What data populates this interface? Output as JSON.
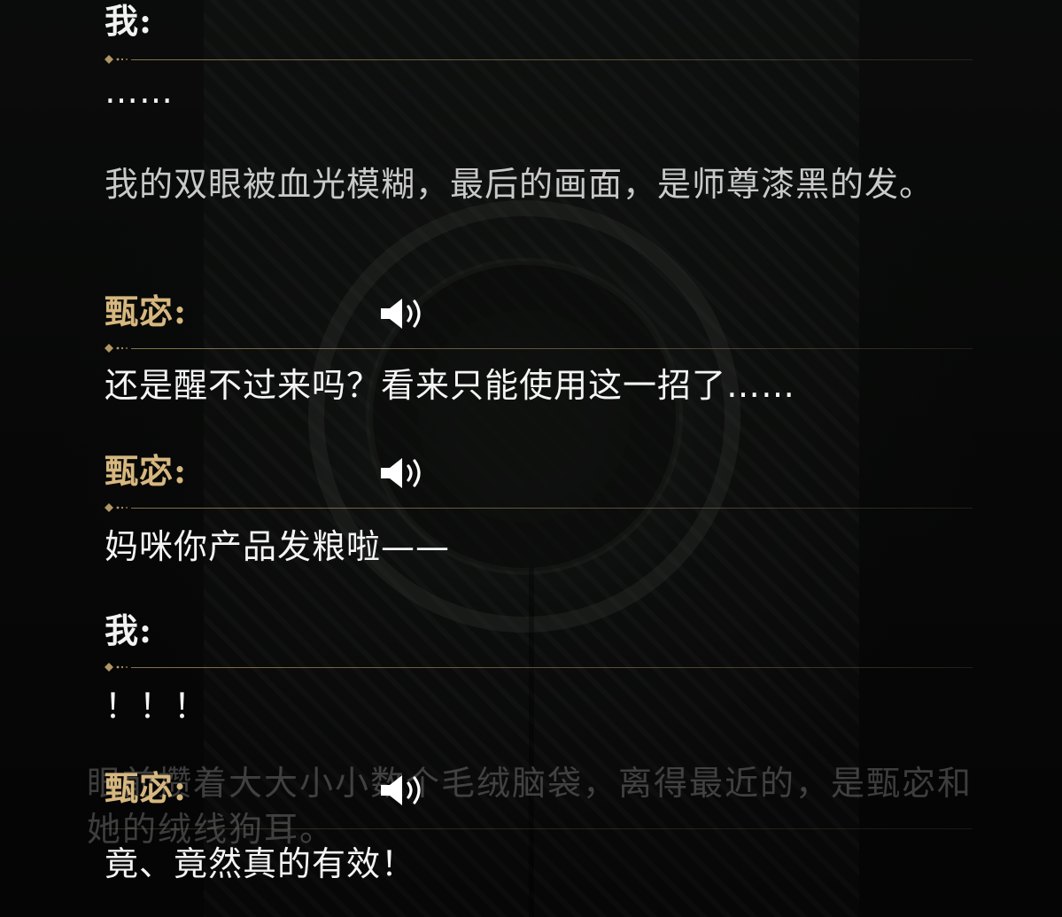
{
  "dialogue_log": [
    {
      "type": "dialogue",
      "speaker": "我:",
      "speaker_role": "player",
      "voice": false,
      "text": "……"
    },
    {
      "type": "narration",
      "text": "我的双眼被血光模糊，最后的画面，是师尊漆黑的发。"
    },
    {
      "type": "dialogue",
      "speaker": "甄宓:",
      "speaker_role": "npc",
      "voice": true,
      "text": "还是醒不过来吗？看来只能使用这一招了……"
    },
    {
      "type": "dialogue",
      "speaker": "甄宓:",
      "speaker_role": "npc",
      "voice": true,
      "text": "妈咪你产品发粮啦——"
    },
    {
      "type": "dialogue",
      "speaker": "我:",
      "speaker_role": "player",
      "voice": false,
      "text": "！！！"
    },
    {
      "type": "dialogue",
      "speaker": "甄宓:",
      "speaker_role": "npc",
      "voice": true,
      "text": "竟、竟然真的有效！"
    }
  ],
  "fading_narration": "眼前攒着大大小小数个毛绒脑袋，离得最近的，是甄宓和她的绒线狗耳。",
  "colors": {
    "player_name": "#f2f2f2",
    "npc_name": "#d6b77f",
    "text": "#f4f4f4",
    "divider": "#b09664",
    "background": "#0b0b0b"
  },
  "icons": {
    "voice": "speaker-volume-icon",
    "divider_ornament": "diamond-ornament-icon"
  }
}
